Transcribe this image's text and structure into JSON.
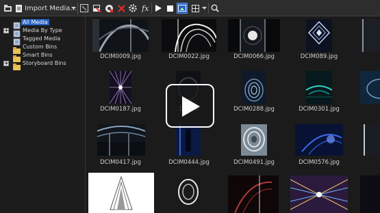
{
  "toolbar": {
    "import_label": "Import Media...",
    "icons": [
      "import-folder-icon",
      "import-dropdown-icon",
      "sizing-icon",
      "media-remove-icon",
      "properties-icon",
      "delete-icon",
      "gear-icon",
      "fx-icon",
      "play-icon",
      "stop-icon",
      "preview-icon",
      "views-icon",
      "views-dropdown-icon",
      "zoom-icon"
    ]
  },
  "sidebar": {
    "items": [
      {
        "label": "All Media",
        "selected": true,
        "icon": "bin-icon"
      },
      {
        "label": "Media By Type",
        "expandable": true,
        "icon": "bin-icon"
      },
      {
        "label": "Tagged Media",
        "icon": "bin-icon"
      },
      {
        "label": "Custom Bins",
        "icon": "folder-icon"
      },
      {
        "label": "Smart Bins",
        "icon": "folder-icon"
      },
      {
        "label": "Storyboard Bins",
        "expandable": true,
        "icon": "folder-icon"
      }
    ]
  },
  "media": {
    "items": [
      {
        "name": "DCIM0009.jpg"
      },
      {
        "name": "DCIM0022.jpg"
      },
      {
        "name": "DCIM0066.jpg"
      },
      {
        "name": "DCIM089.jpg"
      },
      {
        "name": "DCIM0187.jpg"
      },
      {
        "name": "DCIM0"
      },
      {
        "name": "DCIM0288.jpg"
      },
      {
        "name": "DCIM0301.jpg"
      },
      {
        "name": "DCIM0417.jpg"
      },
      {
        "name": "DCIM0444.jpg"
      },
      {
        "name": "DCIM0491.jpg"
      },
      {
        "name": "DCIM0576.jpg"
      }
    ]
  },
  "colors": {
    "accent": "#2a63c4",
    "background": "#1b1b1b",
    "toolbar": "#2d2d2d"
  }
}
